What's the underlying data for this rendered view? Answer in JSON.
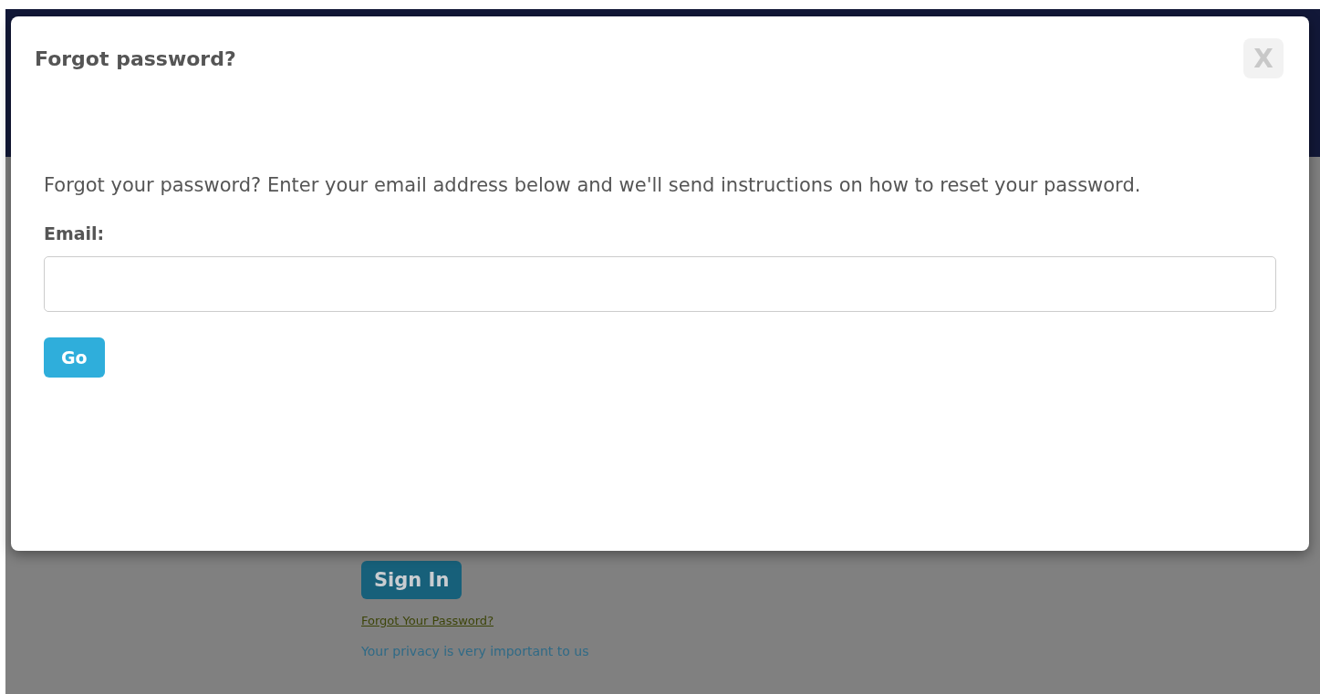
{
  "modal": {
    "title": "Forgot password?",
    "close_label": "X",
    "message": "Forgot your password? Enter your email address below and we'll send instructions on how to reset your password.",
    "email_label": "Email:",
    "go_button": "Go"
  },
  "background": {
    "sign_in_button": "Sign In",
    "forgot_link": "Forgot Your Password?",
    "privacy_text": "Your privacy is very important to us"
  }
}
